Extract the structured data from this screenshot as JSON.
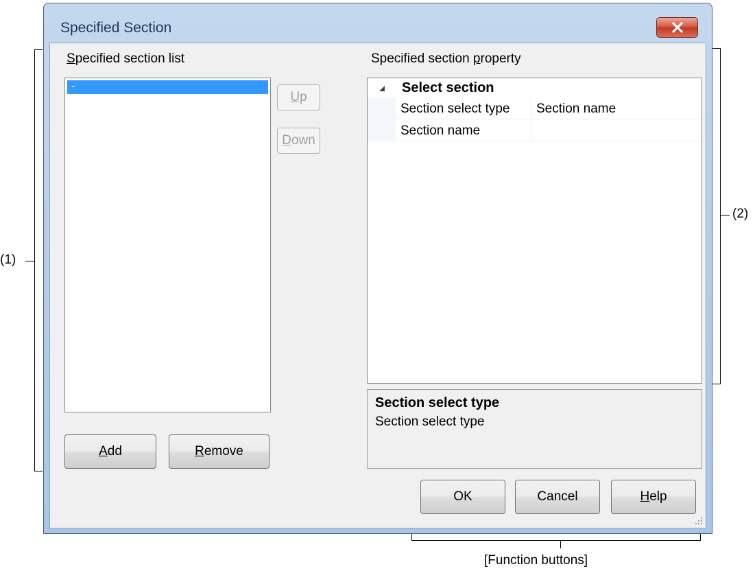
{
  "window": {
    "title": "Specified Section"
  },
  "list_panel": {
    "label_accel": "S",
    "label_rest": "pecified section list",
    "items": [
      "-"
    ],
    "up_accel": "U",
    "up_rest": "p",
    "down_accel": "D",
    "down_rest": "own",
    "add_accel": "A",
    "add_rest": "dd",
    "remove_accel": "R",
    "remove_rest": "emove"
  },
  "property_panel": {
    "label_pre": "Specified section ",
    "label_accel": "p",
    "label_post": "roperty",
    "category": "Select section",
    "rows": [
      {
        "name": "Section select type",
        "value": "Section name"
      },
      {
        "name": "Section name",
        "value": ""
      }
    ],
    "description_title": "Section select type",
    "description_text": "Section select type"
  },
  "buttons": {
    "ok": "OK",
    "cancel": "Cancel",
    "help_accel": "H",
    "help_rest": "elp"
  },
  "annotations": {
    "area1": "(1)",
    "area2": "(2)",
    "function_buttons": "[Function buttons]"
  },
  "colors": {
    "selection": "#3399ff",
    "frame": "#b6cfe9",
    "close_button": "#c2361f"
  }
}
